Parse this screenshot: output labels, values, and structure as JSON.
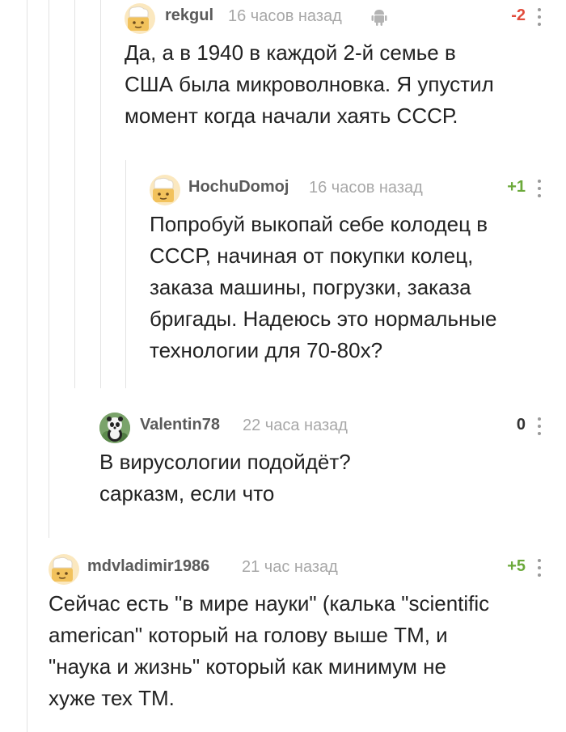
{
  "comments": [
    {
      "author": "rekgul",
      "time": "16 часов назад",
      "rating": "-2",
      "platform_icon": "android-icon",
      "lines": [
        "Да, а в 1940 в каждой 2-й семье в",
        "США была микроволновка. Я упустил",
        "момент когда начали хаять СССР."
      ]
    },
    {
      "author": "HochuDomoj",
      "time": "16 часов назад",
      "rating": "+1",
      "lines": [
        "Попробуй выкопай себе колодец в",
        "СССР, начиная от покупки колец,",
        "заказа машины, погрузки, заказа",
        "бригады. Надеюсь это нормальные",
        "технологии для 70-80х?"
      ]
    },
    {
      "author": "Valentin78",
      "time": "22 часа назад",
      "rating": "0",
      "lines": [
        "В вирусологии подойдёт?",
        "сарказм, если что"
      ]
    },
    {
      "author": "mdvladimir1986",
      "time": "21 час назад",
      "rating": "+5",
      "lines": [
        "Сейчас есть \"в мире науки\" (калька \"scientific",
        "american\" который на голову выше ТМ, и",
        "\"наука и жизнь\" который как минимум не",
        "хуже тех ТМ."
      ]
    }
  ],
  "colors": {
    "negative": "#e14b3b",
    "positive": "#6ba93a",
    "author": "#5a5a5a",
    "time": "#a8a8a8",
    "thread_line": "#e3e3e3"
  }
}
